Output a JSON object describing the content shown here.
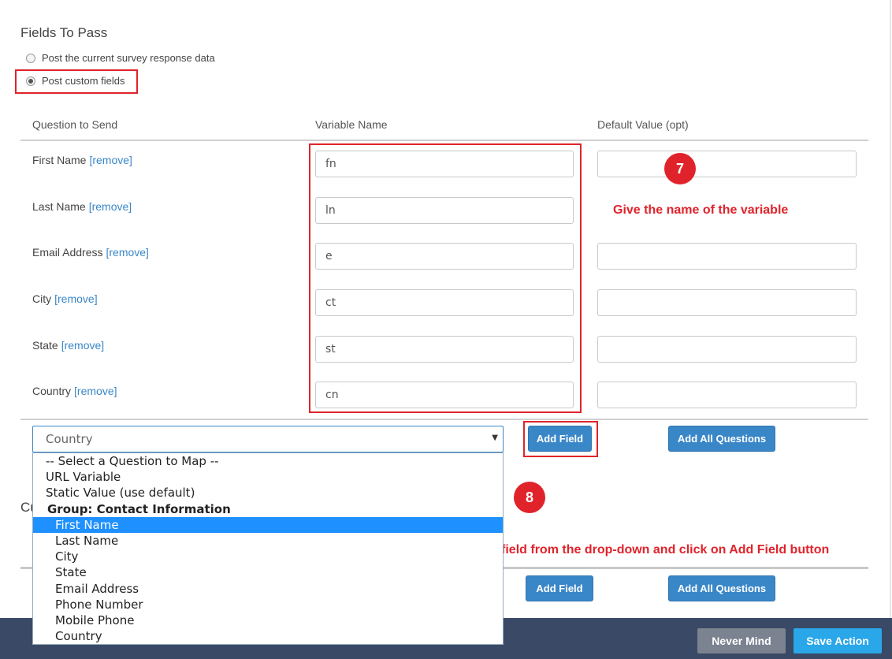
{
  "section": {
    "title": "Fields To Pass"
  },
  "radios": [
    {
      "label": "Post the current survey response data",
      "checked": false
    },
    {
      "label": "Post custom fields",
      "checked": true
    }
  ],
  "table": {
    "headers": [
      "Question to Send",
      "Variable Name",
      "Default Value (opt)"
    ],
    "remove_label": "[remove]",
    "rows": [
      {
        "question": "First Name",
        "variable": "fn",
        "default": ""
      },
      {
        "question": "Last Name",
        "variable": "ln",
        "default": ""
      },
      {
        "question": "Email Address",
        "variable": "e",
        "default": ""
      },
      {
        "question": "City",
        "variable": "ct",
        "default": ""
      },
      {
        "question": "State",
        "variable": "st",
        "default": ""
      },
      {
        "question": "Country",
        "variable": "cn",
        "default": ""
      }
    ]
  },
  "annotations": {
    "step7": "7",
    "step7_text": "Give the name of the variable",
    "step8": "8",
    "step8_text": "Select the field from the drop-down and click on Add Field button"
  },
  "select": {
    "value": "Country",
    "options": [
      {
        "label": "-- Select a Question to Map --",
        "kind": "item"
      },
      {
        "label": "URL Variable",
        "kind": "item"
      },
      {
        "label": "Static Value (use default)",
        "kind": "item"
      },
      {
        "label": "Group: Contact Information",
        "kind": "group"
      },
      {
        "label": "First Name",
        "kind": "sub",
        "selected": true
      },
      {
        "label": "Last Name",
        "kind": "sub"
      },
      {
        "label": "City",
        "kind": "sub"
      },
      {
        "label": "State",
        "kind": "sub"
      },
      {
        "label": "Email Address",
        "kind": "sub"
      },
      {
        "label": "Phone Number",
        "kind": "sub"
      },
      {
        "label": "Mobile Phone",
        "kind": "sub"
      },
      {
        "label": "Country",
        "kind": "sub"
      }
    ]
  },
  "buttons": {
    "add_field": "Add Field",
    "add_all": "Add All Questions",
    "add_field_2": "Add Field",
    "add_all_2": "Add All Questions",
    "never_mind": "Never Mind",
    "save_action": "Save Action"
  },
  "partial_heading": "Cu",
  "colors": {
    "accent": "#3a87c8",
    "annotation": "#e0232b",
    "footer": "#3a4a66",
    "save": "#2aa7e8",
    "cancel": "#7b8290"
  }
}
